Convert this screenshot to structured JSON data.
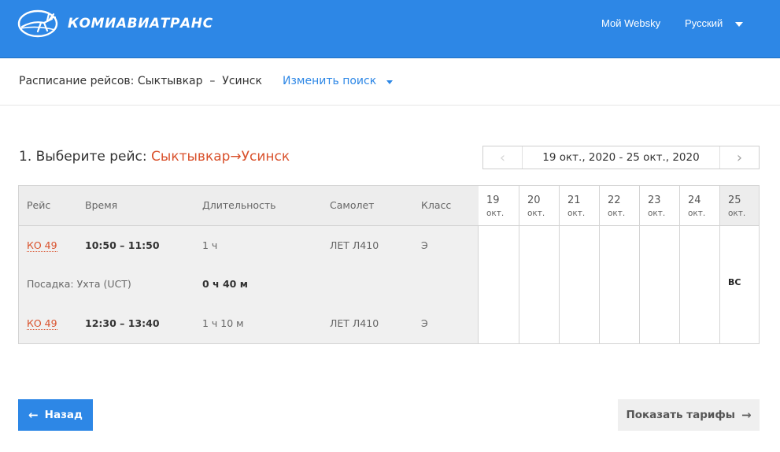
{
  "header": {
    "logo_text": "КОМИАВИАТРАНС",
    "my_websky": "Мой Websky",
    "language": "Русский"
  },
  "subbar": {
    "title": "Расписание рейсов: Сыктывкар  –  Усинск",
    "change_search": "Изменить поиск"
  },
  "step": {
    "prefix": "1. Выберите рейс: ",
    "route": "Сыктывкар→Усинск"
  },
  "datepicker": {
    "prev": "‹",
    "next": "›",
    "range": "19 окт., 2020 - 25 окт., 2020"
  },
  "table": {
    "headers": {
      "flight": "Рейс",
      "time": "Время",
      "duration": "Длительность",
      "aircraft": "Самолет",
      "class": "Класс"
    },
    "segments": [
      {
        "flight": "КО 49",
        "time": "10:50 – 11:50",
        "duration": "1 ч",
        "aircraft": "ЛЕТ Л410",
        "class": "Э"
      },
      {
        "flight": "КО 49",
        "time": "12:30 – 13:40",
        "duration": "1 ч 10 м",
        "aircraft": "ЛЕТ Л410",
        "class": "Э"
      }
    ],
    "stopover": {
      "label": "Посадка: Ухта (UCT)",
      "duration": "0 ч 40 м"
    },
    "days": [
      {
        "num": "19",
        "mon": "окт.",
        "mark": ""
      },
      {
        "num": "20",
        "mon": "окт.",
        "mark": ""
      },
      {
        "num": "21",
        "mon": "окт.",
        "mark": ""
      },
      {
        "num": "22",
        "mon": "окт.",
        "mark": ""
      },
      {
        "num": "23",
        "mon": "окт.",
        "mark": ""
      },
      {
        "num": "24",
        "mon": "окт.",
        "mark": ""
      },
      {
        "num": "25",
        "mon": "окт.",
        "mark": "ВС"
      }
    ]
  },
  "buttons": {
    "back_arrow": "←",
    "back": "Назад",
    "show_fares": "Показать тарифы",
    "fares_arrow": "→"
  },
  "colors": {
    "header_blue": "#2d87e6",
    "route_orange": "#d9512c"
  }
}
